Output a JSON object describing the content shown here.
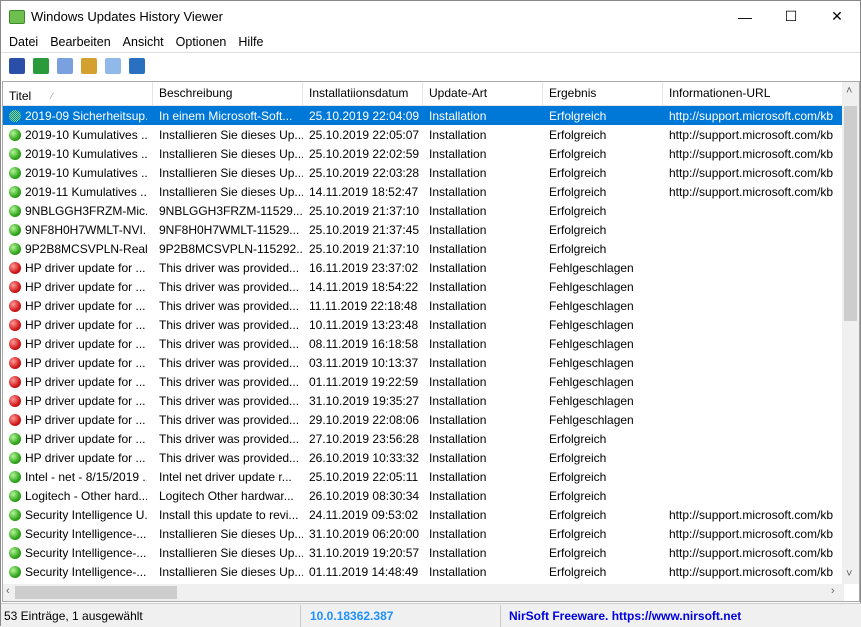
{
  "window": {
    "title": "Windows Updates History Viewer",
    "minimize": "—",
    "maximize": "☐",
    "close": "✕"
  },
  "menu": [
    "Datei",
    "Bearbeiten",
    "Ansicht",
    "Optionen",
    "Hilfe"
  ],
  "toolbar": [
    {
      "icon": "save-icon",
      "color": "#2b4fa8"
    },
    {
      "icon": "refresh-icon",
      "color": "#2a9a3a"
    },
    {
      "icon": "copy-icon",
      "color": "#7aa0e0"
    },
    {
      "icon": "properties-icon",
      "color": "#d4a030"
    },
    {
      "icon": "find-icon",
      "color": "#90b8e8"
    },
    {
      "icon": "exit-icon",
      "color": "#2a70c0"
    }
  ],
  "columns": [
    "Titel",
    "Beschreibung",
    "Installatiionsdatum",
    "Update-Art",
    "Ergebnis",
    "Informationen-URL"
  ],
  "sort_indicator": "⁄",
  "rows": [
    [
      "2019-09 Sicherheitsup...",
      "In einem Microsoft-Soft...",
      "25.10.2019 22:04:09",
      "Installation",
      "Erfolgreich",
      "http://support.microsoft.com/kb"
    ],
    [
      "2019-10 Kumulatives ...",
      "Installieren Sie dieses Up...",
      "25.10.2019 22:05:07",
      "Installation",
      "Erfolgreich",
      "http://support.microsoft.com/kb"
    ],
    [
      "2019-10 Kumulatives ...",
      "Installieren Sie dieses Up...",
      "25.10.2019 22:02:59",
      "Installation",
      "Erfolgreich",
      "http://support.microsoft.com/kb"
    ],
    [
      "2019-10 Kumulatives ...",
      "Installieren Sie dieses Up...",
      "25.10.2019 22:03:28",
      "Installation",
      "Erfolgreich",
      "http://support.microsoft.com/kb"
    ],
    [
      "2019-11 Kumulatives ...",
      "Installieren Sie dieses Up...",
      "14.11.2019 18:52:47",
      "Installation",
      "Erfolgreich",
      "http://support.microsoft.com/kb"
    ],
    [
      "9NBLGGH3FRZM-Mic...",
      "9NBLGGH3FRZM-11529...",
      "25.10.2019 21:37:10",
      "Installation",
      "Erfolgreich",
      ""
    ],
    [
      "9NF8H0H7WMLT-NVI...",
      "9NF8H0H7WMLT-11529...",
      "25.10.2019 21:37:45",
      "Installation",
      "Erfolgreich",
      ""
    ],
    [
      "9P2B8MCSVPLN-Realt...",
      "9P2B8MCSVPLN-115292...",
      "25.10.2019 21:37:10",
      "Installation",
      "Erfolgreich",
      ""
    ],
    [
      "HP driver update for ...",
      "This driver was provided...",
      "16.11.2019 23:37:02",
      "Installation",
      "Fehlgeschlagen",
      ""
    ],
    [
      "HP driver update for ...",
      "This driver was provided...",
      "14.11.2019 18:54:22",
      "Installation",
      "Fehlgeschlagen",
      ""
    ],
    [
      "HP driver update for ...",
      "This driver was provided...",
      "11.11.2019 22:18:48",
      "Installation",
      "Fehlgeschlagen",
      ""
    ],
    [
      "HP driver update for ...",
      "This driver was provided...",
      "10.11.2019 13:23:48",
      "Installation",
      "Fehlgeschlagen",
      ""
    ],
    [
      "HP driver update for ...",
      "This driver was provided...",
      "08.11.2019 16:18:58",
      "Installation",
      "Fehlgeschlagen",
      ""
    ],
    [
      "HP driver update for ...",
      "This driver was provided...",
      "03.11.2019 10:13:37",
      "Installation",
      "Fehlgeschlagen",
      ""
    ],
    [
      "HP driver update for ...",
      "This driver was provided...",
      "01.11.2019 19:22:59",
      "Installation",
      "Fehlgeschlagen",
      ""
    ],
    [
      "HP driver update for ...",
      "This driver was provided...",
      "31.10.2019 19:35:27",
      "Installation",
      "Fehlgeschlagen",
      ""
    ],
    [
      "HP driver update for ...",
      "This driver was provided...",
      "29.10.2019 22:08:06",
      "Installation",
      "Fehlgeschlagen",
      ""
    ],
    [
      "HP driver update for ...",
      "This driver was provided...",
      "27.10.2019 23:56:28",
      "Installation",
      "Erfolgreich",
      ""
    ],
    [
      "HP driver update for ...",
      "This driver was provided...",
      "26.10.2019 10:33:32",
      "Installation",
      "Erfolgreich",
      ""
    ],
    [
      "Intel - net - 8/15/2019 ...",
      "Intel net  driver update r...",
      "25.10.2019 22:05:11",
      "Installation",
      "Erfolgreich",
      ""
    ],
    [
      "Logitech - Other hard...",
      "Logitech Other hardwar...",
      "26.10.2019 08:30:34",
      "Installation",
      "Erfolgreich",
      ""
    ],
    [
      "Security Intelligence U...",
      "Install this update to revi...",
      "24.11.2019 09:53:02",
      "Installation",
      "Erfolgreich",
      "http://support.microsoft.com/kb"
    ],
    [
      "Security Intelligence-...",
      "Installieren Sie dieses Up...",
      "31.10.2019 06:20:00",
      "Installation",
      "Erfolgreich",
      "http://support.microsoft.com/kb"
    ],
    [
      "Security Intelligence-...",
      "Installieren Sie dieses Up...",
      "31.10.2019 19:20:57",
      "Installation",
      "Erfolgreich",
      "http://support.microsoft.com/kb"
    ],
    [
      "Security Intelligence-...",
      "Installieren Sie dieses Up...",
      "01.11.2019 14:48:49",
      "Installation",
      "Erfolgreich",
      "http://support.microsoft.com/kb"
    ]
  ],
  "selected_row": 0,
  "status": {
    "count": "53 Einträge, 1 ausgewählt",
    "version": "10.0.18362.387",
    "credit": "NirSoft Freeware. https://www.nirsoft.net"
  },
  "colors": {
    "selection": "#0078d7",
    "link": "#1e90ff",
    "credit": "#0000e0"
  }
}
